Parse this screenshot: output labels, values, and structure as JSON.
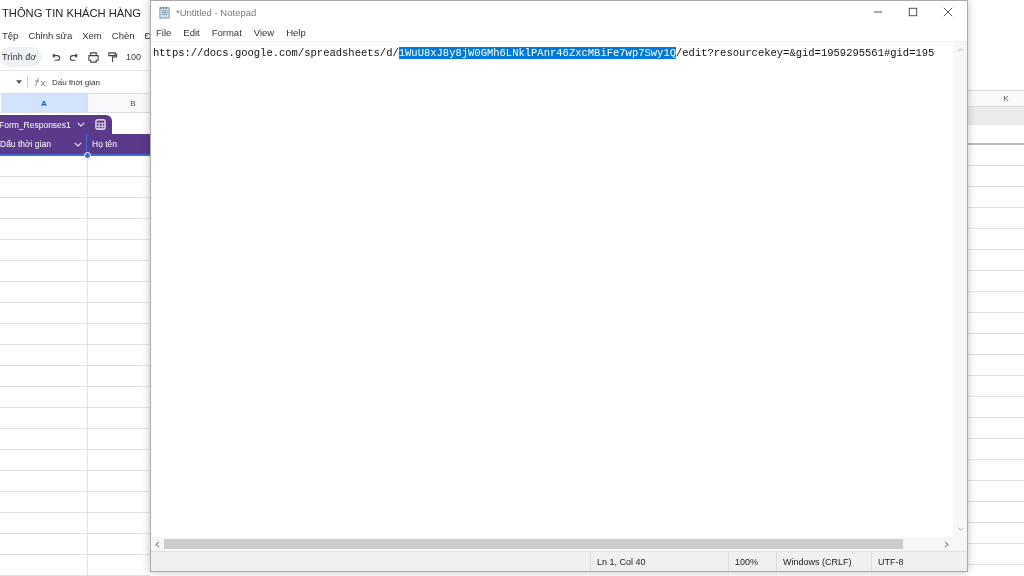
{
  "spreadsheet": {
    "title": "THÔNG TIN KHÁCH HÀNG",
    "menu": [
      "Tệp",
      "Chỉnh sửa",
      "Xem",
      "Chèn",
      "Đ"
    ],
    "toolbar": {
      "search_placeholder": "Trình đơ",
      "zoom": "100"
    },
    "formula_bar": {
      "value": "Dấu thời gian"
    },
    "column_headers": [
      {
        "label": "A",
        "selected": true
      },
      {
        "label": "B",
        "selected": false
      }
    ],
    "right_column_header": "K",
    "table": {
      "name": "Form_Responses1",
      "columns": [
        "Dấu thời gian",
        "Họ tên"
      ]
    }
  },
  "notepad": {
    "title": "*Untitled - Notepad",
    "menu": [
      "File",
      "Edit",
      "Format",
      "View",
      "Help"
    ],
    "text": [
      {
        "text": "https://docs.google.com/spreadsheets/d/",
        "selected": false
      },
      {
        "text": "1WuU8xJ8y8jW0GMh6LNklPAnr46ZxcMBiFe7wp7Swy1Q",
        "selected": true
      },
      {
        "text": "/edit?resourcekey=&gid=1959295561#gid=195",
        "selected": false
      }
    ],
    "status_bar": [
      "Ln 1, Col 40",
      "100%",
      "Windows (CRLF)",
      "UTF-8"
    ]
  }
}
